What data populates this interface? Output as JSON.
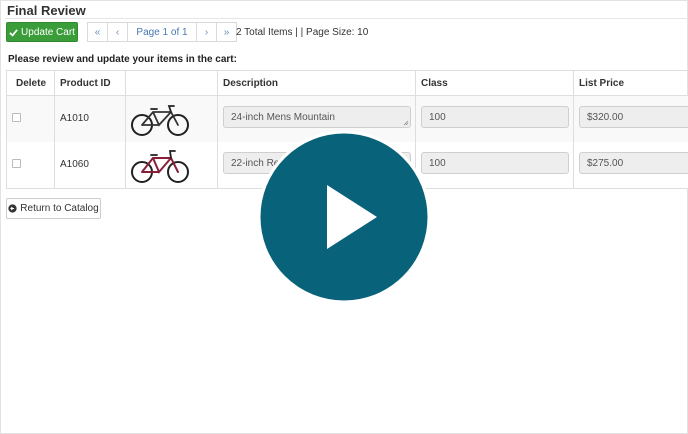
{
  "page": {
    "title": "Final Review"
  },
  "toolbar": {
    "update_label": "Update Cart"
  },
  "pager": {
    "first": "«",
    "prev": "‹",
    "page_label": "Page 1 of 1",
    "next": "›",
    "last": "»",
    "info": "2 Total Items | | Page Size: 10"
  },
  "instructions": "Please review and update your items in the cart:",
  "table": {
    "headers": {
      "delete": "Delete",
      "product_id": "Product ID",
      "image": "",
      "description": "Description",
      "class": "Class",
      "list_price": "List Price"
    },
    "rows": [
      {
        "product_id": "A1010",
        "description": "24-inch Mens Mountain",
        "class": "100",
        "list_price": "$320.00",
        "bike_color": "#333333"
      },
      {
        "product_id": "A1060",
        "description": "22-inch Re",
        "class": "100",
        "list_price": "$275.00",
        "bike_color": "#8a1f3a"
      }
    ]
  },
  "footer": {
    "return_label": "Return to Catalog"
  },
  "video": {
    "play_color": "#08627a"
  },
  "colors": {
    "accent_green": "#3a9d3a",
    "link_blue": "#337ab7"
  }
}
